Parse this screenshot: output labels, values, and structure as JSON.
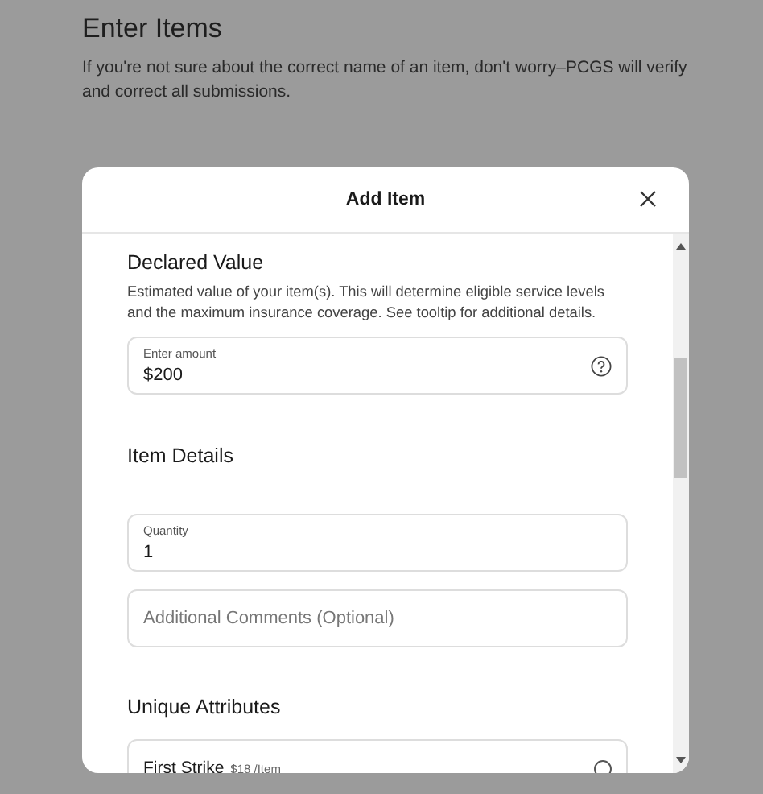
{
  "page": {
    "title": "Enter Items",
    "intro": "If you're not sure about the correct name of an item, don't worry–PCGS will verify and correct all submissions."
  },
  "dialog": {
    "title": "Add Item",
    "declared_value": {
      "heading": "Declared Value",
      "description": "Estimated value of your item(s). This will determine eligible service levels and the maximum insurance coverage. See tooltip for additional details.",
      "field": {
        "label": "Enter amount",
        "value": "$200"
      }
    },
    "item_details": {
      "heading": "Item Details",
      "quantity": {
        "label": "Quantity",
        "value": "1"
      },
      "comments": {
        "placeholder": "Additional Comments (Optional)"
      }
    },
    "unique_attributes": {
      "heading": "Unique Attributes",
      "options": [
        {
          "name": "First Strike",
          "price": "$18 /Item",
          "selected": false
        }
      ]
    }
  }
}
